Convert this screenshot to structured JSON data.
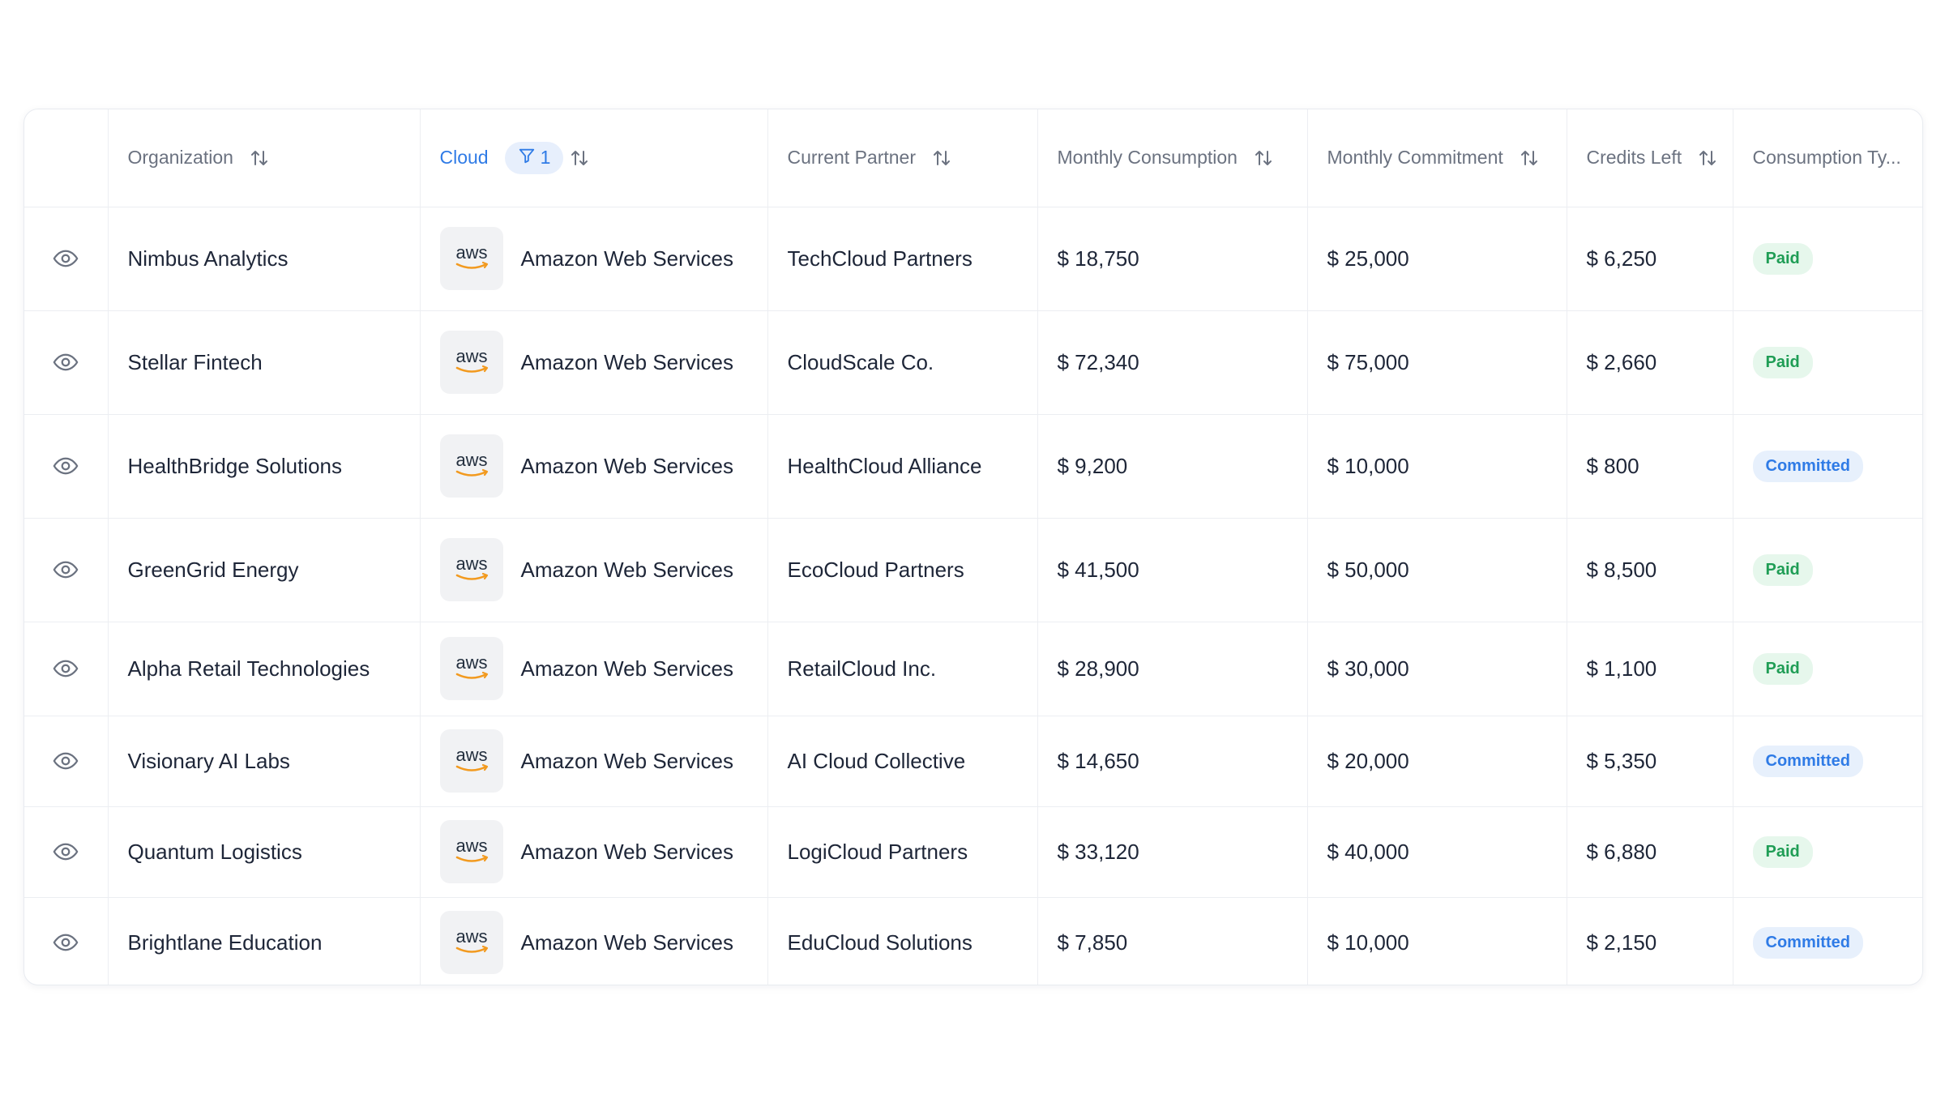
{
  "columns": {
    "organization": "Organization",
    "cloud": "Cloud",
    "cloud_filter_count": "1",
    "current_partner": "Current Partner",
    "monthly_consumption": "Monthly Consumption",
    "monthly_commitment": "Monthly Commitment",
    "credits_left": "Credits Left",
    "consumption_type": "Consumption Ty..."
  },
  "icons": {
    "view": "eye-icon",
    "sort": "sort-arrows-icon",
    "filter": "filter-icon",
    "cloud_logo": "aws-logo"
  },
  "colors": {
    "accent": "#2f7be6",
    "paid_text": "#1f9d55",
    "paid_bg": "#e6f7ec",
    "committed_text": "#2f7be6",
    "committed_bg": "#e7f0fc"
  },
  "rows": [
    {
      "organization": "Nimbus Analytics",
      "logo_text": "aws",
      "cloud": "Amazon Web Services",
      "partner": "TechCloud Partners",
      "consumption": "$ 18,750",
      "commitment": "$ 25,000",
      "credits": "$ 6,250",
      "type": "Paid"
    },
    {
      "organization": "Stellar Fintech",
      "logo_text": "aws",
      "cloud": "Amazon Web Services",
      "partner": "CloudScale Co.",
      "consumption": "$ 72,340",
      "commitment": "$ 75,000",
      "credits": "$ 2,660",
      "type": "Paid"
    },
    {
      "organization": "HealthBridge Solutions",
      "logo_text": "aws",
      "cloud": "Amazon Web Services",
      "partner": "HealthCloud Alliance",
      "consumption": "$ 9,200",
      "commitment": "$ 10,000",
      "credits": "$ 800",
      "type": "Committed"
    },
    {
      "organization": "GreenGrid Energy",
      "logo_text": "aws",
      "cloud": "Amazon Web Services",
      "partner": "EcoCloud Partners",
      "consumption": "$ 41,500",
      "commitment": "$ 50,000",
      "credits": "$ 8,500",
      "type": "Paid"
    },
    {
      "organization": "Alpha Retail Technologies",
      "logo_text": "aws",
      "cloud": "Amazon Web Services",
      "partner": "RetailCloud Inc.",
      "consumption": "$ 28,900",
      "commitment": "$ 30,000",
      "credits": "$ 1,100",
      "type": "Paid"
    },
    {
      "organization": "Visionary AI Labs",
      "logo_text": "aws",
      "cloud": "Amazon Web Services",
      "partner": "AI Cloud Collective",
      "consumption": "$ 14,650",
      "commitment": "$ 20,000",
      "credits": "$ 5,350",
      "type": "Committed"
    },
    {
      "organization": "Quantum Logistics",
      "logo_text": "aws",
      "cloud": "Amazon Web Services",
      "partner": "LogiCloud Partners",
      "consumption": "$ 33,120",
      "commitment": "$ 40,000",
      "credits": "$ 6,880",
      "type": "Paid"
    },
    {
      "organization": "Brightlane Education",
      "logo_text": "aws",
      "cloud": "Amazon Web Services",
      "partner": "EduCloud Solutions",
      "consumption": "$ 7,850",
      "commitment": "$ 10,000",
      "credits": "$ 2,150",
      "type": "Committed"
    }
  ]
}
